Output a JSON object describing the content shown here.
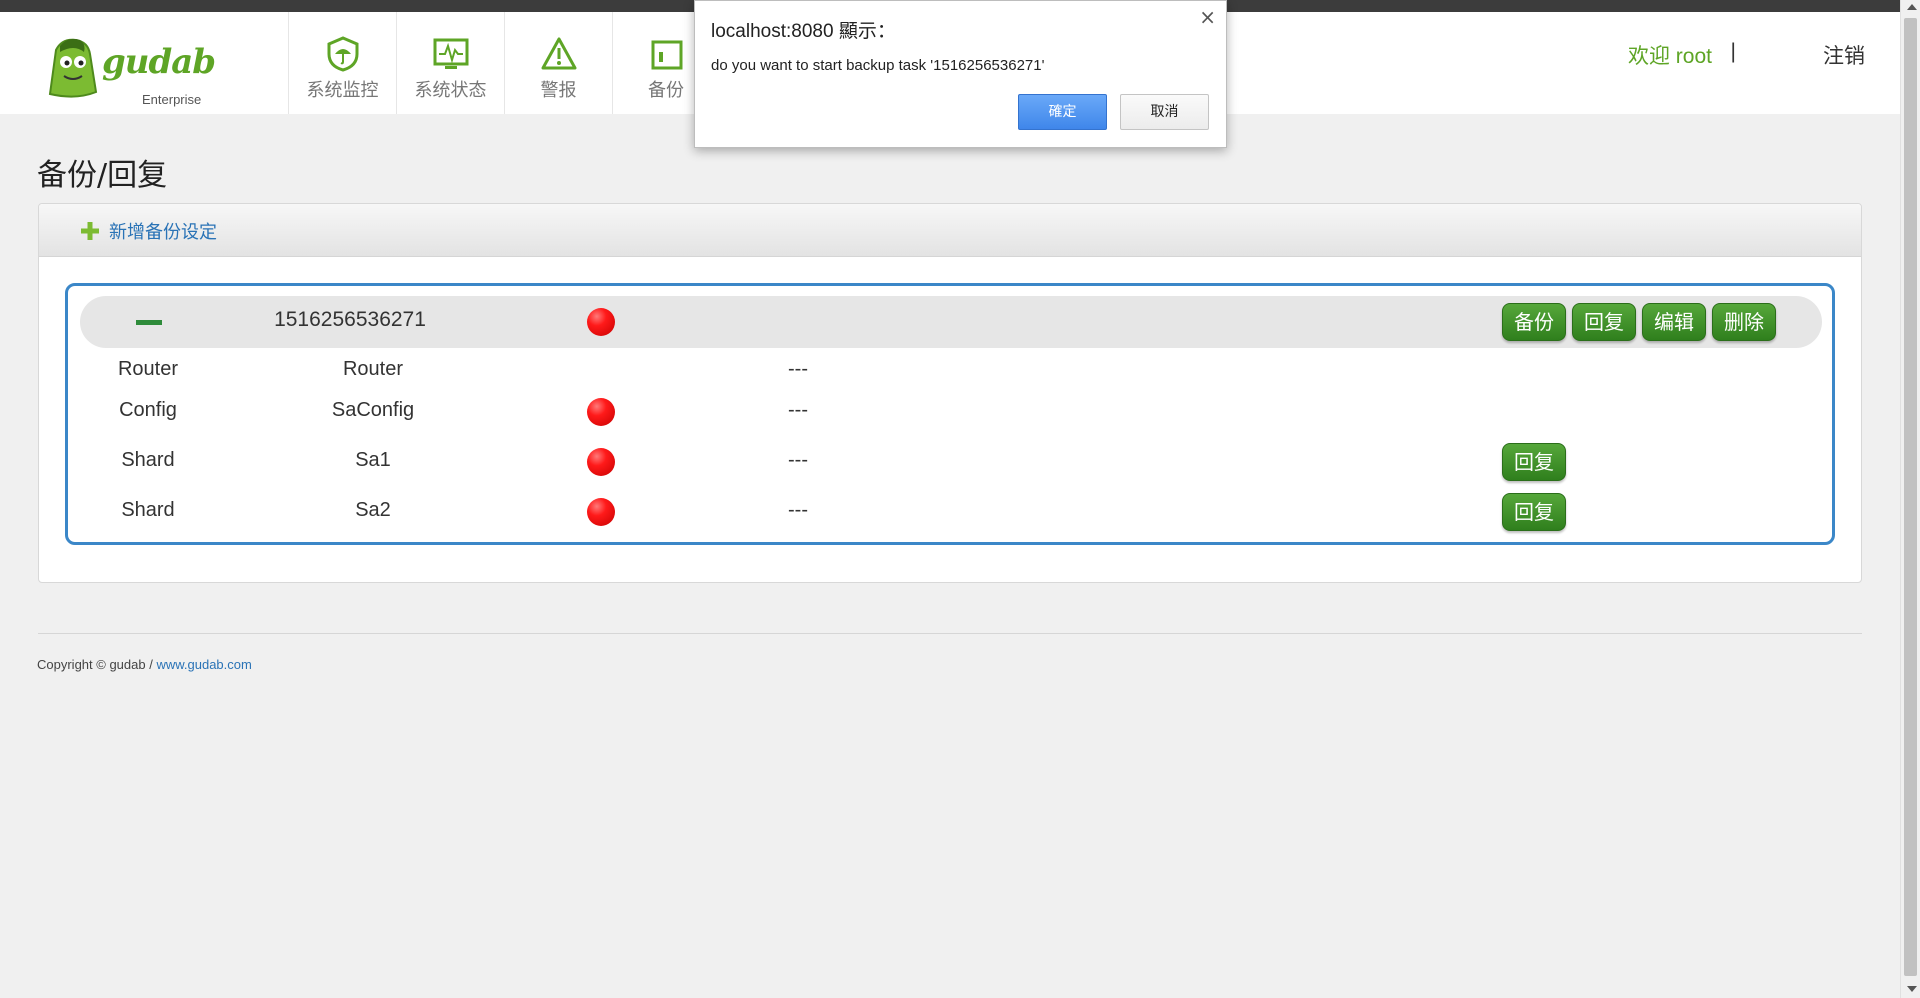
{
  "header": {
    "logo_text": "gudab",
    "logo_sub": "Enterprise",
    "nav": [
      {
        "label": "系统监控",
        "icon": "umbrella-shield-icon"
      },
      {
        "label": "系统状态",
        "icon": "monitor-pulse-icon"
      },
      {
        "label": "警报",
        "icon": "warning-triangle-icon"
      },
      {
        "label": "备份",
        "icon": "backup-icon"
      }
    ],
    "welcome": "欢迎 root",
    "separator": "|",
    "logout": "注销"
  },
  "page": {
    "title": "备份/回复",
    "add_backup": "新增备份设定"
  },
  "task": {
    "id": "1516256536271",
    "actions": [
      "备份",
      "回复",
      "编辑",
      "删除"
    ],
    "nodes": [
      {
        "type": "Router",
        "name": "Router",
        "status": "---",
        "has_dot": false,
        "restore": false
      },
      {
        "type": "Config",
        "name": "SaConfig",
        "status": "---",
        "has_dot": true,
        "restore": false
      },
      {
        "type": "Shard",
        "name": "Sa1",
        "status": "---",
        "has_dot": true,
        "restore": true,
        "restore_label": "回复"
      },
      {
        "type": "Shard",
        "name": "Sa2",
        "status": "---",
        "has_dot": true,
        "restore": true,
        "restore_label": "回复"
      }
    ]
  },
  "footer": {
    "copyright": "Copyright © gudab  /",
    "link": "www.gudab.com"
  },
  "dialog": {
    "title": "localhost:8080 顯示：",
    "message": "do you want to start backup task '1516256536271'",
    "ok": "確定",
    "cancel": "取消",
    "close": "×"
  },
  "colors": {
    "brand_green": "#5ea526",
    "button_green": "#3a8a25",
    "link_blue": "#2a73b6",
    "task_border": "#3b87c8",
    "status_red": "#ff1a1a"
  }
}
